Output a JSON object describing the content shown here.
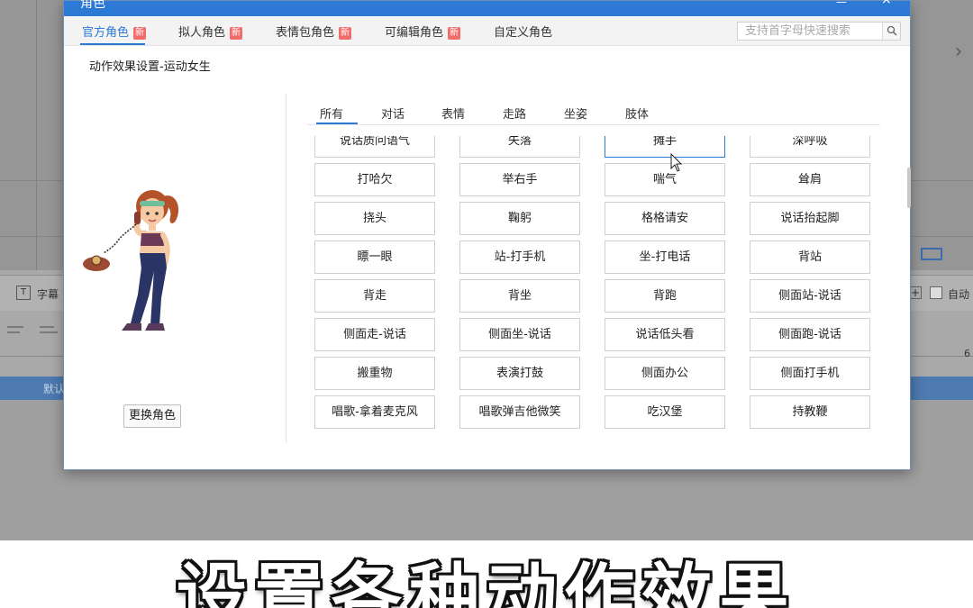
{
  "dialog": {
    "title": "角色",
    "tabs": [
      {
        "label": "官方角色",
        "badge": "新"
      },
      {
        "label": "拟人角色",
        "badge": "新"
      },
      {
        "label": "表情包角色",
        "badge": "新"
      },
      {
        "label": "可编辑角色",
        "badge": "新"
      },
      {
        "label": "自定义角色",
        "badge": ""
      }
    ],
    "search": {
      "placeholder": "支持首字母快速搜索"
    },
    "settings_title": "动作效果设置-运动女生",
    "change_role_label": "更换角色",
    "action_tabs": [
      "所有",
      "对话",
      "表情",
      "走路",
      "坐姿",
      "肢体"
    ],
    "actions": [
      [
        "说话质问语气",
        "失落",
        "摊手",
        "深呼吸"
      ],
      [
        "打哈欠",
        "举右手",
        "喘气",
        "耸肩"
      ],
      [
        "挠头",
        "鞠躬",
        "格格请安",
        "说话抬起脚"
      ],
      [
        "瞟一眼",
        "站-打手机",
        "坐-打电话",
        "背站"
      ],
      [
        "背走",
        "背坐",
        "背跑",
        "侧面站-说话"
      ],
      [
        "侧面走-说话",
        "侧面坐-说话",
        "说话低头看",
        "侧面跑-说话"
      ],
      [
        "搬重物",
        "表演打鼓",
        "侧面办公",
        "侧面打手机"
      ],
      [
        "唱歌-拿着麦克风",
        "唱歌弹吉他微笑",
        "吃汉堡",
        "持教鞭"
      ]
    ],
    "selected_action": "摊手"
  },
  "background": {
    "subtitle_label": "字幕",
    "auto_label": "自动",
    "ruler_number": "6",
    "track_label": "默认"
  },
  "caption": "设置各种动作效果",
  "colors": {
    "accent": "#2d7ad6",
    "badge": "#f26b6b"
  }
}
